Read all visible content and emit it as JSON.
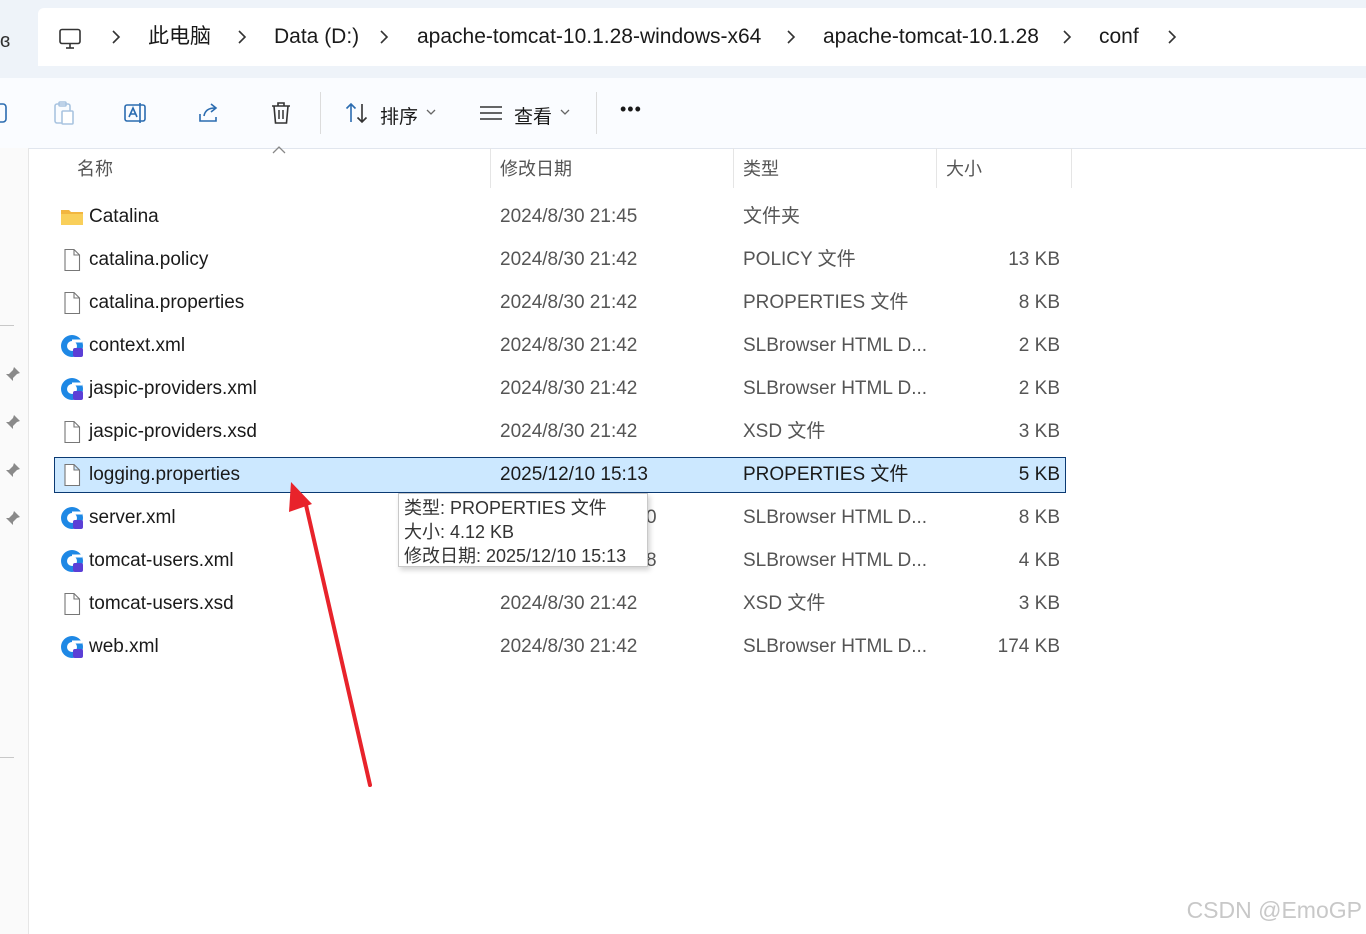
{
  "breadcrumbs": [
    "此电脑",
    "Data (D:)",
    "apache-tomcat-10.1.28-windows-x64",
    "apache-tomcat-10.1.28",
    "conf"
  ],
  "toolbar": {
    "sort_label": "排序",
    "view_label": "查看",
    "more_label": "•••"
  },
  "columns": {
    "name": "名称",
    "date": "修改日期",
    "type": "类型",
    "size": "大小"
  },
  "files": [
    {
      "name": "Catalina",
      "date": "2024/8/30 21:45",
      "type": "文件夹",
      "size": "",
      "icon": "folder-icon"
    },
    {
      "name": "catalina.policy",
      "date": "2024/8/30 21:42",
      "type": "POLICY 文件",
      "size": "13 KB",
      "icon": "file-icon"
    },
    {
      "name": "catalina.properties",
      "date": "2024/8/30 21:42",
      "type": "PROPERTIES 文件",
      "size": "8 KB",
      "icon": "file-icon"
    },
    {
      "name": "context.xml",
      "date": "2024/8/30 21:42",
      "type": "SLBrowser HTML D...",
      "size": "2 KB",
      "icon": "browser-icon"
    },
    {
      "name": "jaspic-providers.xml",
      "date": "2024/8/30 21:42",
      "type": "SLBrowser HTML D...",
      "size": "2 KB",
      "icon": "browser-icon"
    },
    {
      "name": "jaspic-providers.xsd",
      "date": "2024/8/30 21:42",
      "type": "XSD 文件",
      "size": "3 KB",
      "icon": "file-icon"
    },
    {
      "name": "logging.properties",
      "date": "2025/12/10 15:13",
      "type": "PROPERTIES 文件",
      "size": "5 KB",
      "icon": "file-icon"
    },
    {
      "name": "server.xml",
      "date": "",
      "type": "SLBrowser HTML D...",
      "size": "8 KB",
      "icon": "browser-icon"
    },
    {
      "name": "tomcat-users.xml",
      "date": "",
      "type": "SLBrowser HTML D...",
      "size": "4 KB",
      "icon": "browser-icon"
    },
    {
      "name": "tomcat-users.xsd",
      "date": "2024/8/30 21:42",
      "type": "XSD 文件",
      "size": "3 KB",
      "icon": "file-icon"
    },
    {
      "name": "web.xml",
      "date": "2024/8/30 21:42",
      "type": "SLBrowser HTML D...",
      "size": "174 KB",
      "icon": "browser-icon"
    }
  ],
  "tooltip": {
    "type_line": "类型: PROPERTIES 文件",
    "size_line": "大小: 4.12 KB",
    "date_line": "修改日期: 2025/12/10 15:13"
  },
  "partial": {
    "left_edge_glyph": "ɞ",
    "server_date_tail": "0",
    "tomcat_date_tail": "8"
  },
  "watermark": "CSDN @EmoGP",
  "colors": {
    "selection": "#cce8ff",
    "selection_border": "#0b3a73",
    "arrow": "#e8232b",
    "folder": "#f7c64a",
    "browser": "#1e88e5"
  }
}
